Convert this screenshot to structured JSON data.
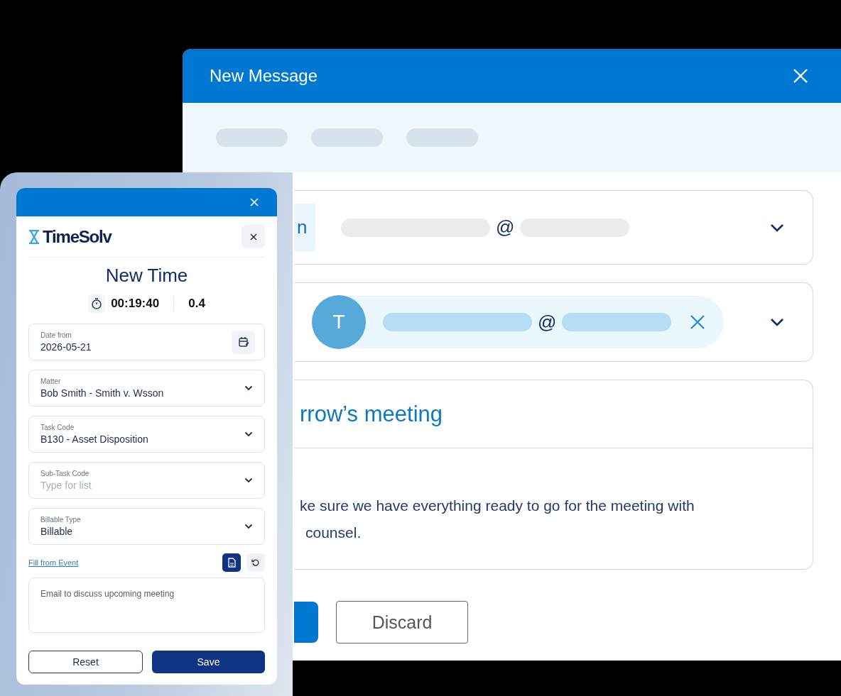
{
  "message_window": {
    "title": "New Message",
    "from_row": {
      "label": "n",
      "at": "@"
    },
    "to_row": {
      "avatar": "T",
      "at": "@"
    },
    "subject": "rrow’s meeting",
    "body_lines": [
      "ke sure we have everything ready to go for the meeting with",
      "counsel."
    ],
    "discard_button": "Discard"
  },
  "time_entry": {
    "app_name": "TimeSolv",
    "title": "New Time",
    "timer": "00:19:40",
    "hours": "0.4",
    "fields": [
      {
        "kind": "date",
        "label": "Date from",
        "value": "2026-05-21"
      },
      {
        "kind": "select",
        "label": "Matter",
        "value": "Bob Smith - Smith v. Wsson"
      },
      {
        "kind": "select",
        "label": "Task Code",
        "value": "B130 - Asset Disposition"
      },
      {
        "kind": "select",
        "label": "Sub-Task Code",
        "placeholder": "Type for list"
      },
      {
        "kind": "select",
        "label": "Billable Type",
        "value": "Billable"
      }
    ],
    "link": "Fill from Event",
    "description": "Email to discuss upcoming meeting",
    "reset_button": "Reset",
    "save_button": "Save"
  }
}
